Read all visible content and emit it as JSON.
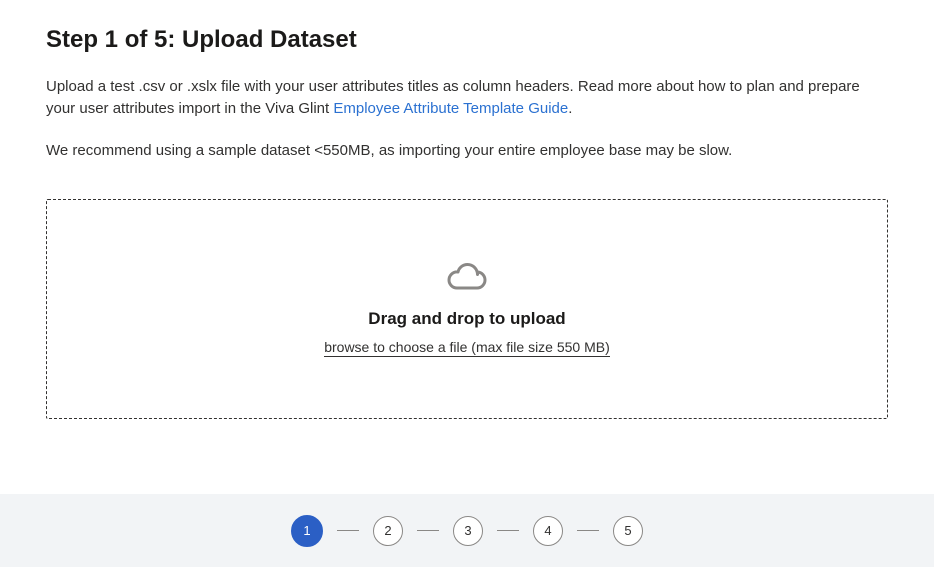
{
  "header": {
    "title": "Step 1 of 5: Upload Dataset"
  },
  "intro": {
    "part1": "Upload a test .csv or .xslx file with your user attributes titles as column headers. Read more about how to plan and prepare your user attributes import in the Viva Glint ",
    "link_text": "Employee Attribute Template Guide",
    "part2": "."
  },
  "note": "We recommend using a sample dataset <550MB, as importing your entire employee base may be slow.",
  "dropzone": {
    "title": "Drag and drop to upload",
    "browse": "browse to choose a file (max file size 550 MB)"
  },
  "stepper": {
    "current": 1,
    "steps": [
      "1",
      "2",
      "3",
      "4",
      "5"
    ]
  }
}
